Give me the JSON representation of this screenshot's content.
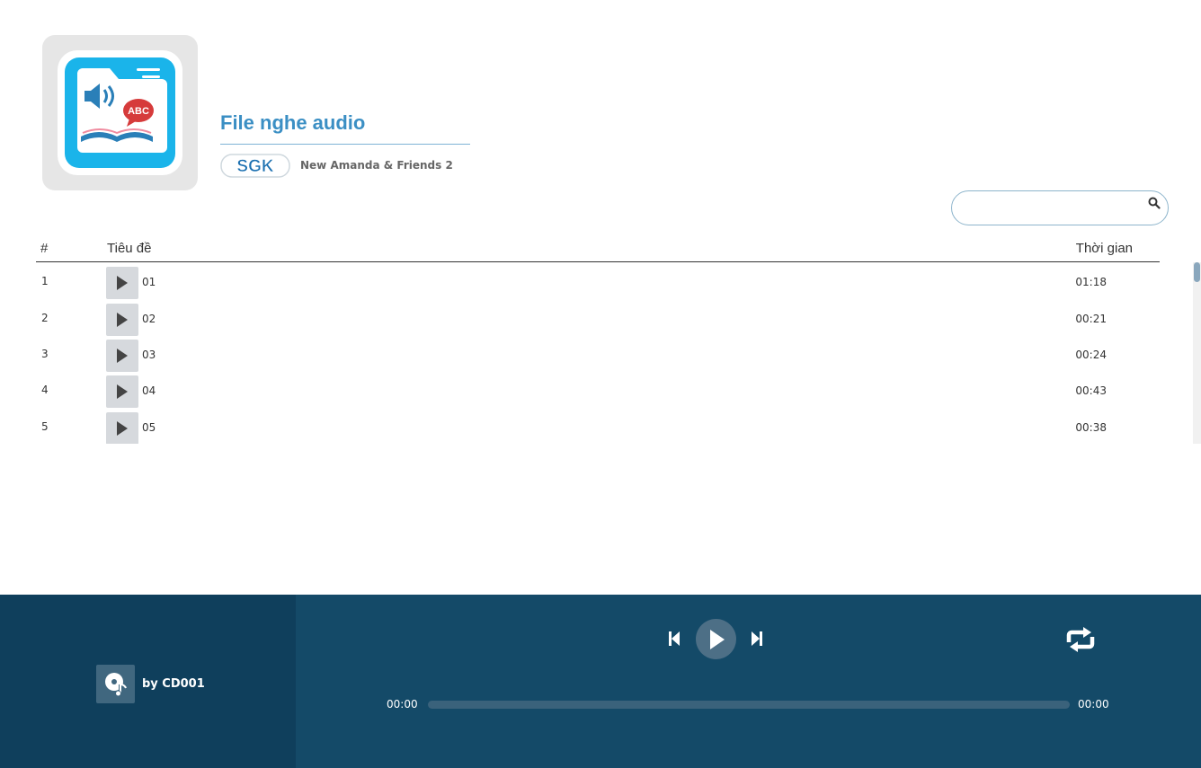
{
  "header": {
    "title": "File nghe audio",
    "publisher_logo_text": "SGK",
    "book_name": "New Amanda & Friends 2"
  },
  "search": {
    "placeholder": "",
    "value": ""
  },
  "table": {
    "columns": {
      "num": "#",
      "title": "Tiêu đề",
      "time": "Thời gian"
    },
    "rows": [
      {
        "num": "1",
        "name": "01",
        "duration": "01:18"
      },
      {
        "num": "2",
        "name": "02",
        "duration": "00:21"
      },
      {
        "num": "3",
        "name": "03",
        "duration": "00:24"
      },
      {
        "num": "4",
        "name": "04",
        "duration": "00:43"
      },
      {
        "num": "5",
        "name": "05",
        "duration": "00:38"
      }
    ]
  },
  "player": {
    "byline": "by CD001",
    "current_time": "00:00",
    "total_time": "00:00",
    "progress": 0
  },
  "icons": {
    "cover": "audio-book-folder-icon",
    "search": "search-icon",
    "row_play": "play-icon",
    "cd": "cd-music-icon",
    "prev": "skip-previous-icon",
    "play": "play-icon",
    "next": "skip-next-icon",
    "repeat": "repeat-icon"
  },
  "colors": {
    "accent": "#3b8fc4",
    "player_bg": "#144a68",
    "player_left_bg": "#0f3f5c"
  }
}
